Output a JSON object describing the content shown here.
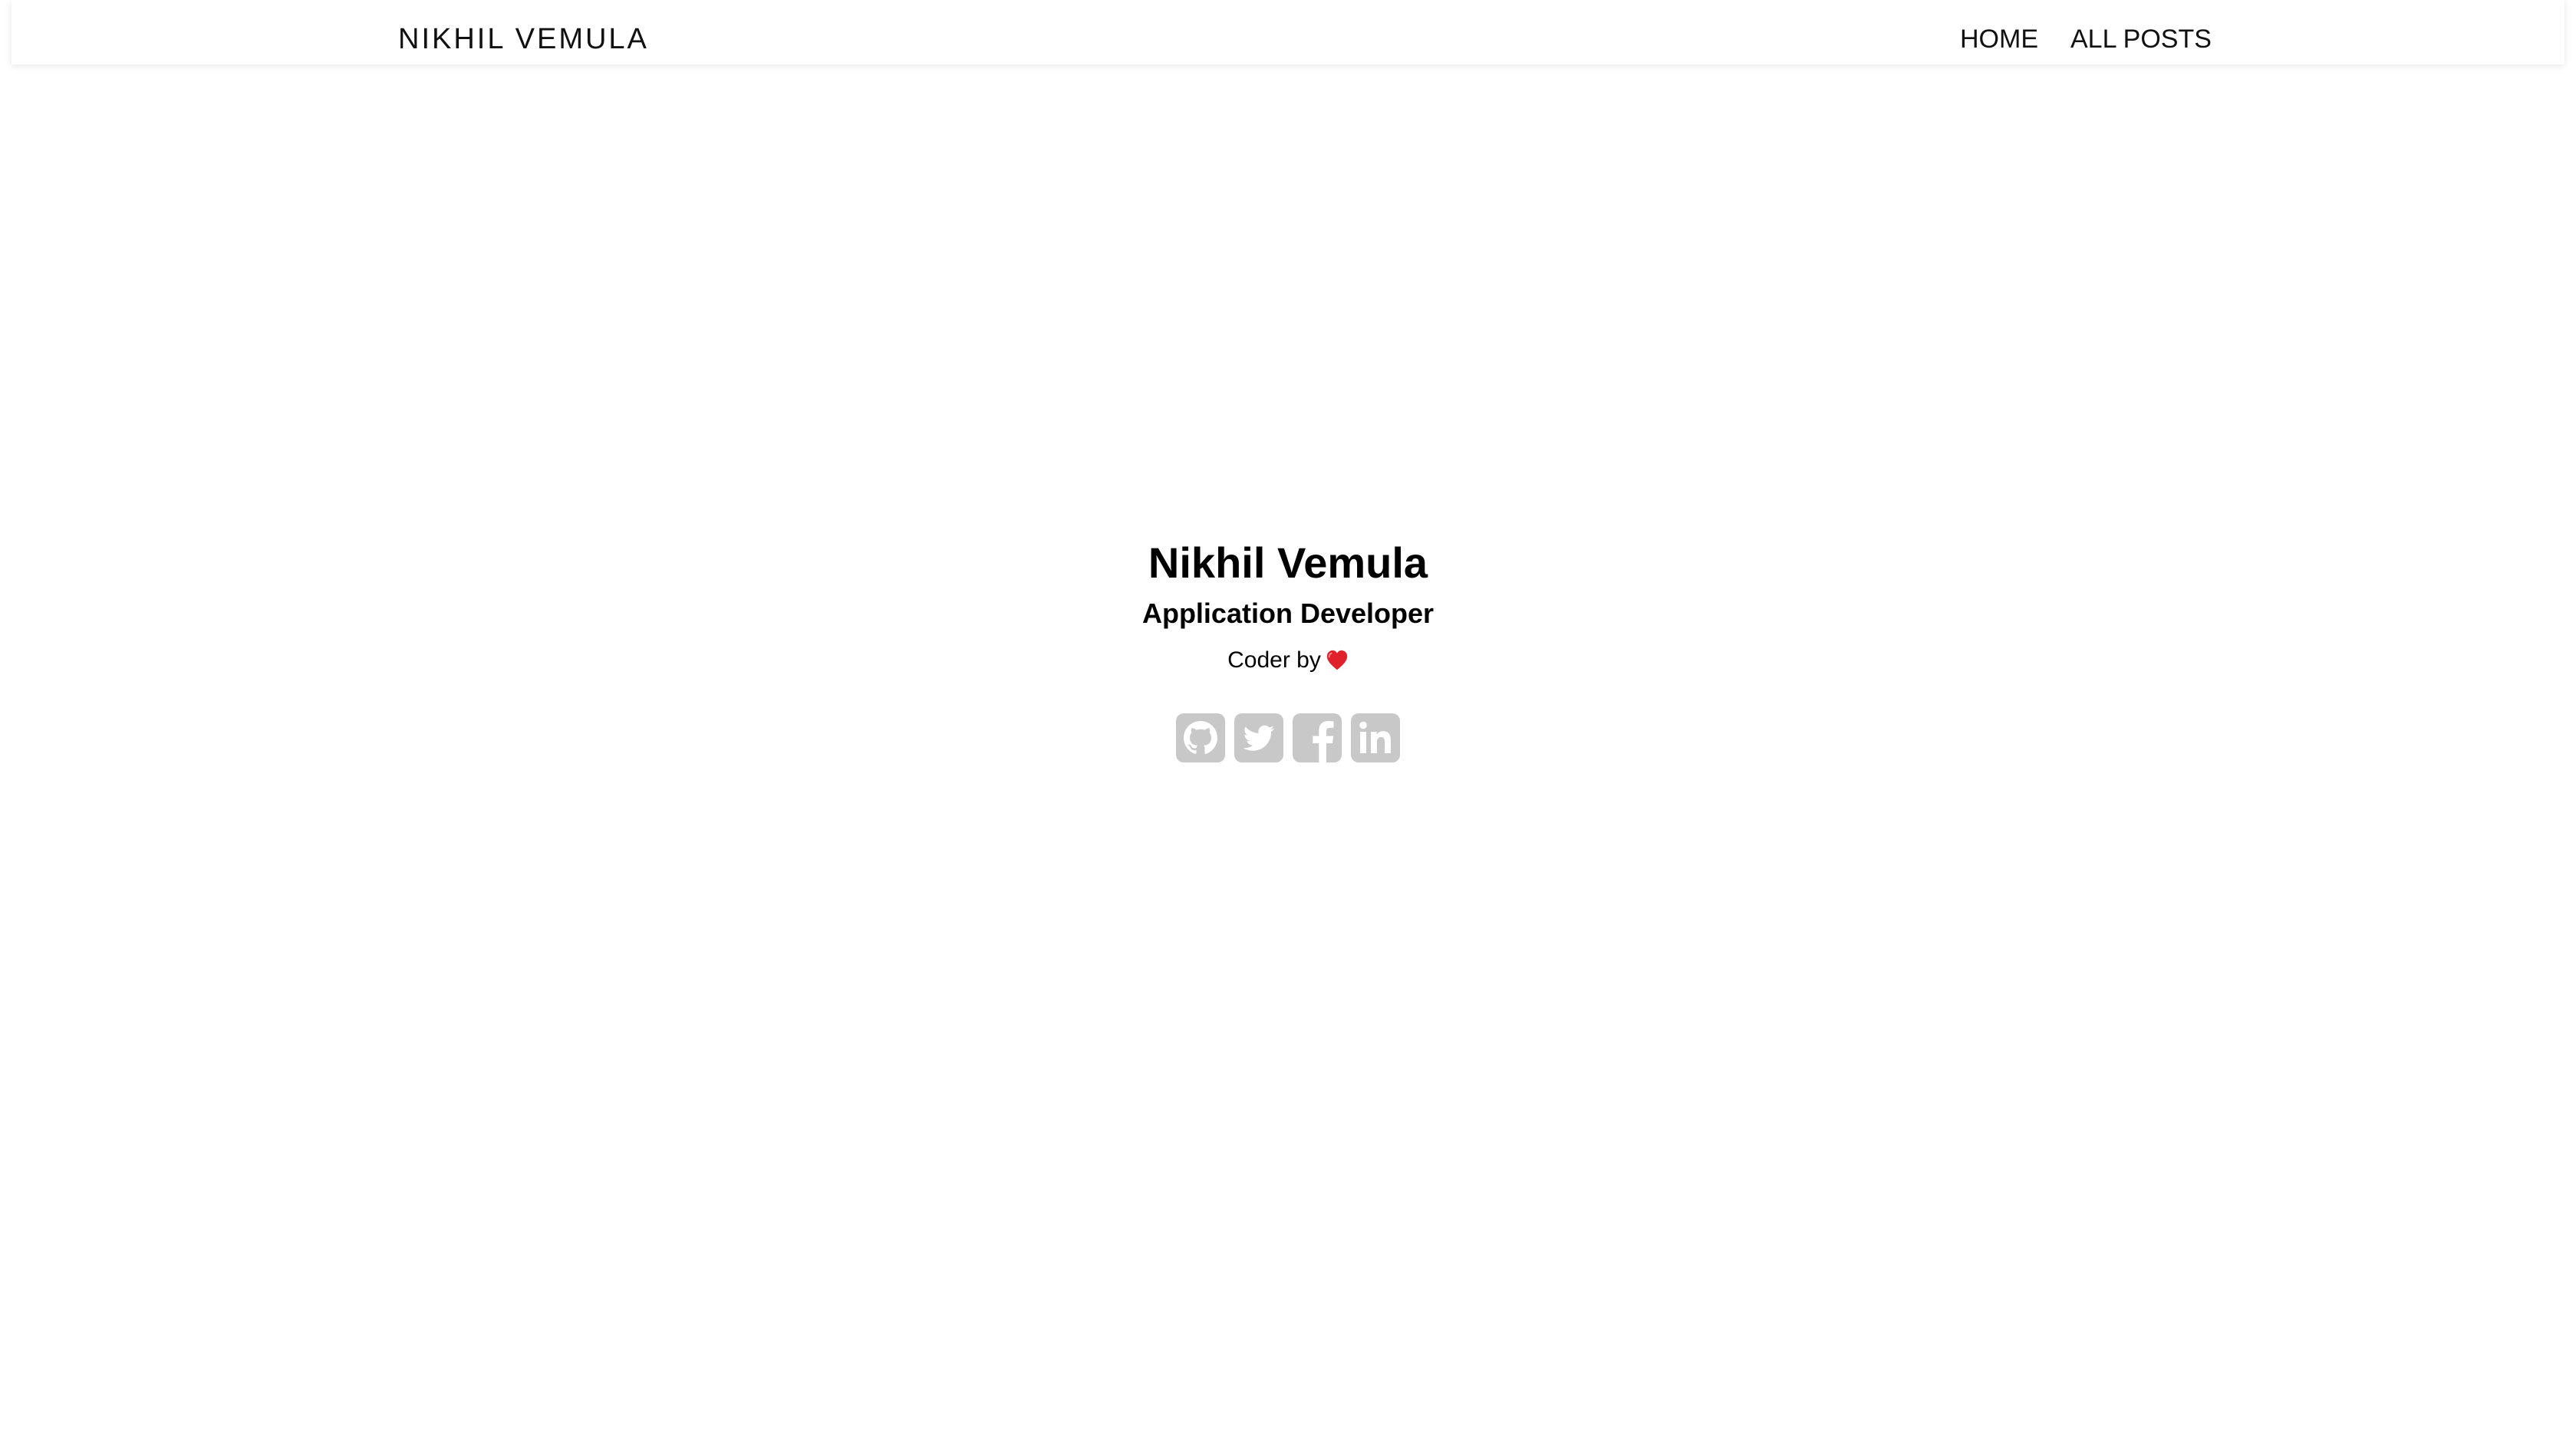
{
  "header": {
    "brand": "NIKHIL VEMULA",
    "nav": [
      {
        "label": "HOME"
      },
      {
        "label": "ALL POSTS"
      }
    ]
  },
  "hero": {
    "name": "Nikhil Vemula",
    "role": "Application Developer",
    "tagline": "Coder by",
    "tagline_icon": "heart-icon"
  },
  "social": {
    "icons": [
      "github-icon",
      "twitter-icon",
      "facebook-icon",
      "linkedin-icon"
    ],
    "icon_color": "#c8c8c8"
  },
  "colors": {
    "heart": "#e0212b",
    "text": "#000000"
  }
}
